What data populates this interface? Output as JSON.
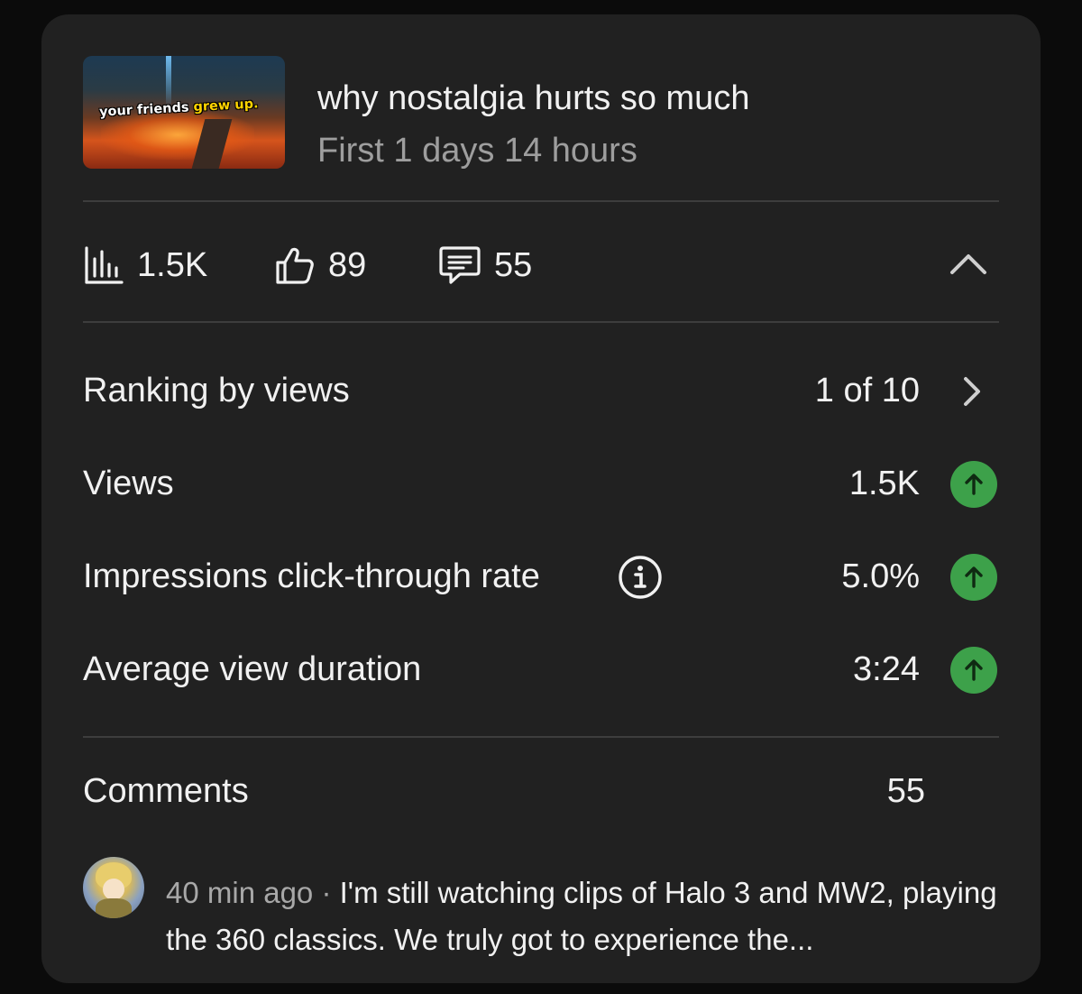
{
  "video": {
    "title": "why nostalgia hurts so much",
    "subtitle": "First 1 days 14 hours",
    "thumbnail_caption_white": "your friends",
    "thumbnail_caption_yellow": "grew up."
  },
  "stats": {
    "views": "1.5K",
    "likes": "89",
    "comments": "55",
    "icons": [
      "bar-chart-icon",
      "thumbs-up-icon",
      "comment-icon",
      "chevron-up-icon"
    ]
  },
  "metrics": [
    {
      "label": "Ranking by views",
      "value": "1 of 10",
      "indicator": "chevron-right-icon"
    },
    {
      "label": "Views",
      "value": "1.5K",
      "indicator": "trend-up-icon"
    },
    {
      "label": "Impressions click-through rate",
      "value": "5.0%",
      "indicator": "trend-up-icon",
      "has_info": true
    },
    {
      "label": "Average view duration",
      "value": "3:24",
      "indicator": "trend-up-icon"
    }
  ],
  "comments_section": {
    "label": "Comments",
    "count": "55",
    "latest": {
      "time": "40 min ago",
      "separator": " · ",
      "text": "I'm still watching clips of Halo 3 and MW2, playing the 360 classics. We truly got to experience the..."
    }
  },
  "colors": {
    "card_bg": "#212121",
    "page_bg": "#0b0b0b",
    "trend_up_green": "#3da14a",
    "secondary_text": "#9e9e9e"
  }
}
